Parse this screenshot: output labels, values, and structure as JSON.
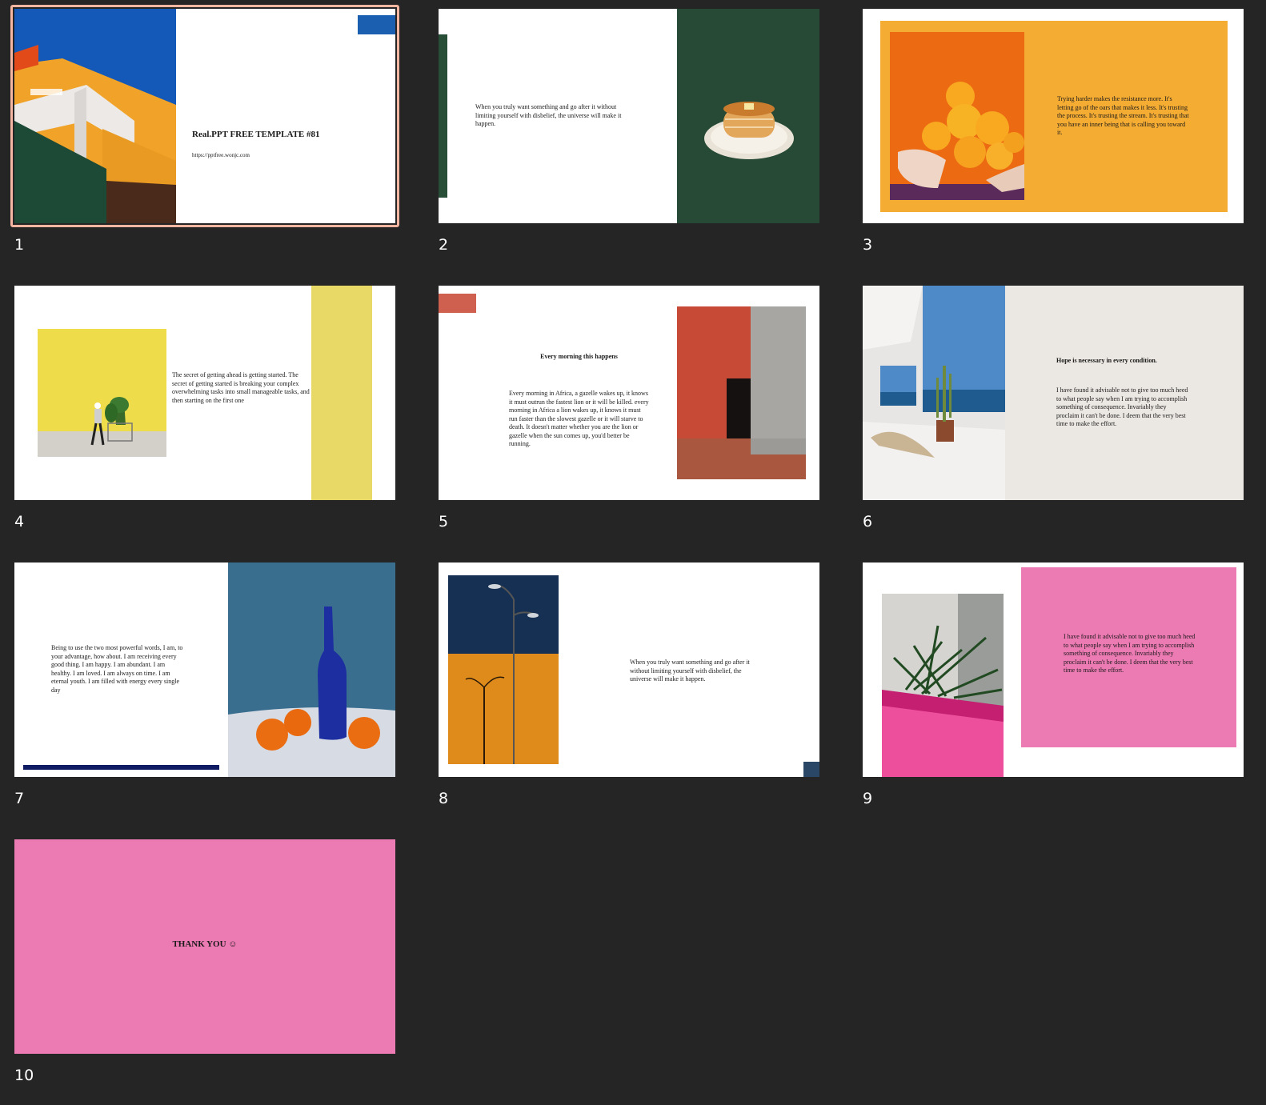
{
  "slides": [
    {
      "number": "1",
      "title": "Real.PPT FREE TEMPLATE #81",
      "url": "https://pptfree.wonjc.com",
      "accent": "#1b5fb0"
    },
    {
      "number": "2",
      "body": "When you truly want something and go after it without limiting yourself  with disbelief, the universe will make it happen.",
      "accent": "#284e37"
    },
    {
      "number": "3",
      "body": "Trying harder makes the resistance more. It's letting go of  the oars that makes it less. It's trusting the process. It's trusting the stream. It's trusting that you have an inner being that is calling you toward it.",
      "accent": "#f5ac33"
    },
    {
      "number": "4",
      "body": "The secret of  getting ahead is getting started. The secret of  getting started is breaking your complex overwhelming tasks into small manageable tasks, and then starting on the first one",
      "accent": "#e8d866"
    },
    {
      "number": "5",
      "heading": "Every morning this happens",
      "body": "Every morning in Africa, a gazelle wakes up, it knows it must outrun the fastest lion or it will be killed. every morning in Africa a lion wakes up, it knows it must run faster than the slowest gazelle or it will starve to death. It doesn't matter whether you are the lion or gazelle when the sun comes up, you'd better be running.",
      "accent": "#cf5f4e"
    },
    {
      "number": "6",
      "heading": "Hope is necessary in every condition.",
      "body": "I have found it advisable not to give too much heed to what people say when I am trying to accomplish something of consequence. Invariably they proclaim it can't be done. I deem that the very best time to make the effort.",
      "accent": "#ebe7e2"
    },
    {
      "number": "7",
      "body": "Being to use the two most powerful words, I am, to your advantage, how about. I am receiving every good thing. I am happy. I am abundant. I am healthy. I am loved. I am always on time. I am eternal youth. I am filled with energy every single day",
      "accent": "#0f1b63"
    },
    {
      "number": "8",
      "body": "When you truly want something and go after it without limiting yourself  with disbelief, the universe will make it happen.",
      "accent": "#2a4767"
    },
    {
      "number": "9",
      "body": "I have found it advisable not to give too much heed to what people say when I am trying to accomplish something of consequence. Invariably they proclaim it can't be done. I deem that the very best time to make the effort.",
      "accent": "#ec7ab3"
    },
    {
      "number": "10",
      "title": "THANK YOU ☺",
      "accent": "#ec7ab3"
    }
  ]
}
